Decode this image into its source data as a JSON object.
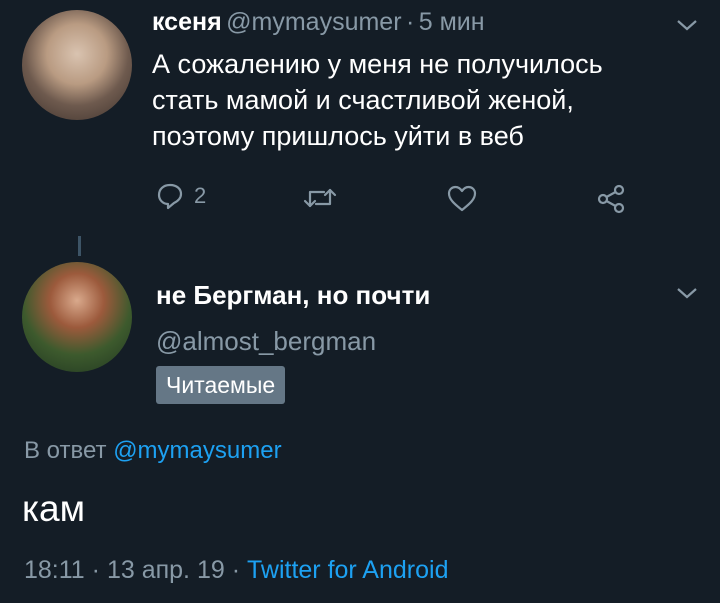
{
  "tweet": {
    "author_name": "ксеня",
    "author_handle": "@mymaysumer",
    "separator": "·",
    "time_ago": "5 мин",
    "text_lines": [
      "А сожалению у меня не получилось",
      "стать мамой и счастливой женой,",
      "поэтому пришлось уйти в веб"
    ],
    "reply_count": "2",
    "icons": [
      "reply-icon",
      "retweet-icon",
      "like-icon",
      "share-icon",
      "chevron-down-icon"
    ]
  },
  "reply": {
    "author_name": "не Бергман, но почти",
    "author_handle": "@almost_bergman",
    "badge": "Читаемые",
    "in_reply_prefix": "В ответ",
    "in_reply_handle": "@mymaysumer",
    "text": "кам",
    "time": "18:11",
    "separator": "·",
    "date": "13 апр. 19",
    "separator2": "·",
    "source": "Twitter for Android"
  },
  "colors": {
    "background": "#141d26",
    "muted": "#8899a6",
    "accent": "#1da1f2",
    "badge": "#657786"
  }
}
